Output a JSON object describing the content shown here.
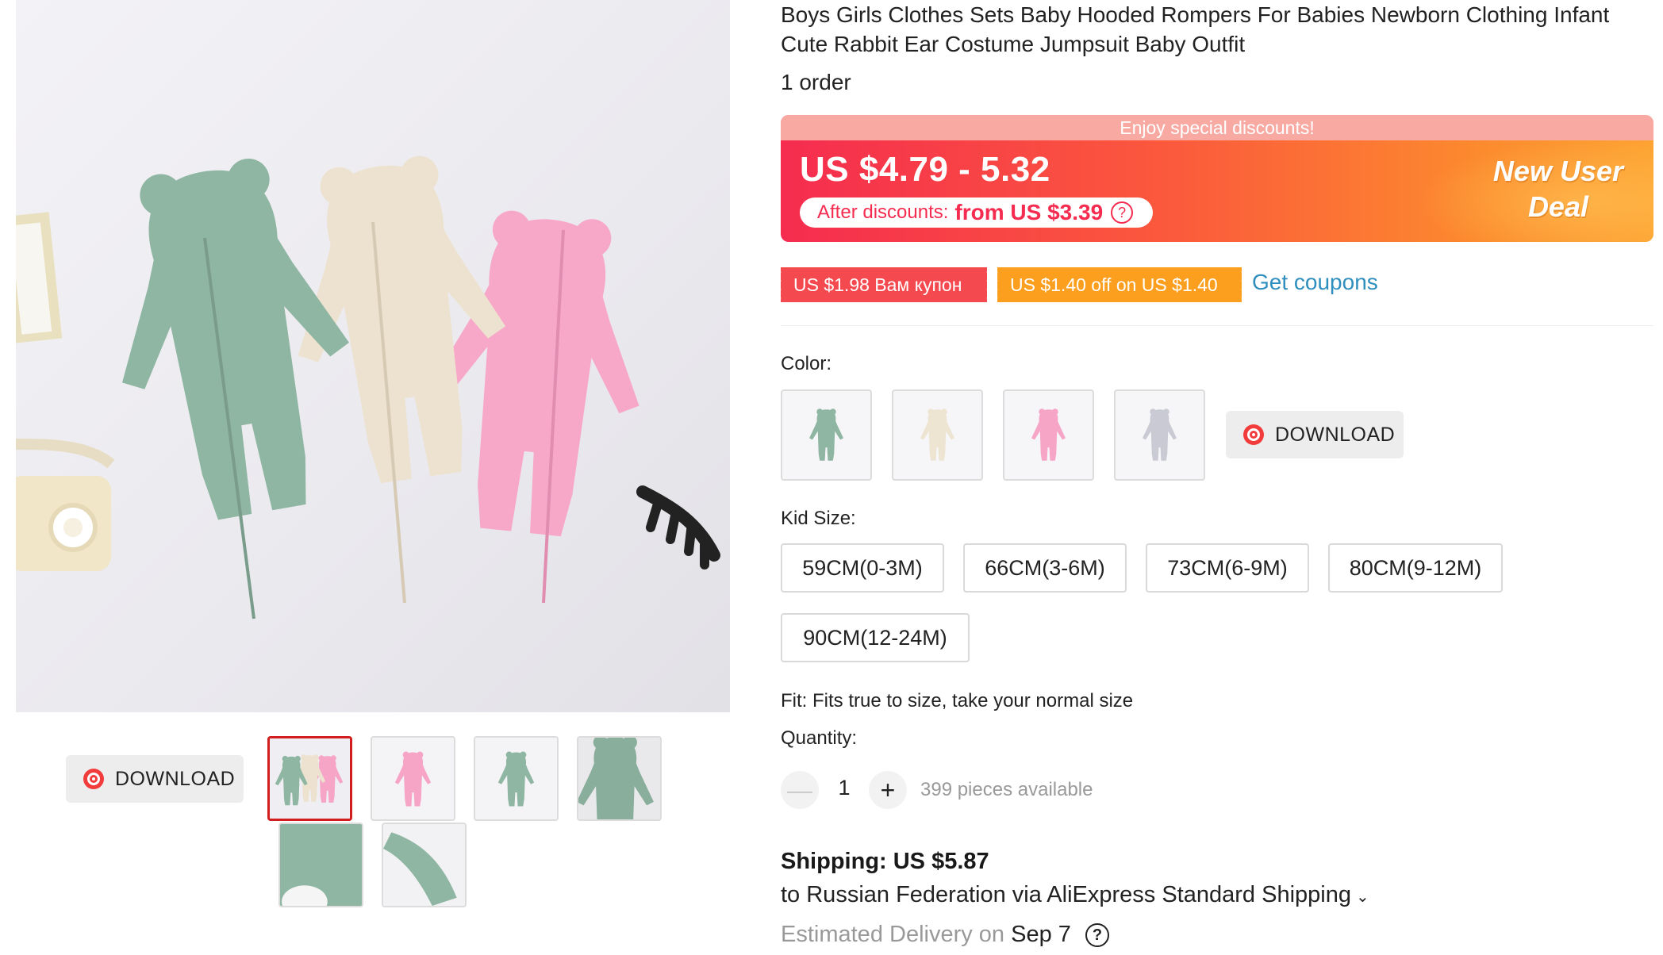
{
  "product": {
    "title": "Boys Girls Clothes Sets Baby Hooded Rompers For Babies Newborn Clothing Infant Cute Rabbit Ear Costume Jumpsuit Baby Outfit",
    "orders": "1 order"
  },
  "gallery": {
    "download_label": "DOWNLOAD",
    "thumbnails": [
      "three-rompers",
      "pink-romper",
      "green-romper",
      "green-hood-closeup",
      "green-fabric-closeup",
      "green-cuff-closeup"
    ],
    "selected_index": 0
  },
  "price": {
    "banner_top": "Enjoy special discounts!",
    "range": "US $4.79 - 5.32",
    "after_label": "After discounts:",
    "after_value": "from US $3.39",
    "help_glyph": "?",
    "deal_line1": "New User",
    "deal_line2": "Deal"
  },
  "coupons": {
    "coupon1": "US $1.98 Вам купон",
    "coupon2": "US $1.40 off on US $1.40",
    "get_coupons": "Get coupons"
  },
  "color": {
    "label": "Color:",
    "options": [
      "green",
      "beige",
      "pink",
      "grey"
    ],
    "download_label": "DOWNLOAD"
  },
  "size": {
    "label": "Kid Size:",
    "options": [
      "59CM(0-3M)",
      "66CM(3-6M)",
      "73CM(6-9M)",
      "80CM(9-12M)",
      "90CM(12-24M)"
    ]
  },
  "fit": "Fit: Fits true to size, take your normal size",
  "quantity": {
    "label": "Quantity:",
    "minus": "—",
    "value": "1",
    "plus": "+",
    "available": "399 pieces available"
  },
  "shipping": {
    "cost": "Shipping: US $5.87",
    "route": "to Russian Federation via AliExpress Standard Shipping",
    "chevron": "⌄",
    "delivery_label": "Estimated Delivery on",
    "delivery_date": "Sep 7",
    "help_glyph": "?"
  },
  "colors": {
    "accent_red": "#f52c4f",
    "accent_orange": "#fd9f1e",
    "link_blue": "#2e8fbe",
    "romper_green": "#8fb7a4",
    "romper_beige": "#eee4d2",
    "romper_pink": "#f6a5c7",
    "romper_grey": "#c9cad3"
  }
}
